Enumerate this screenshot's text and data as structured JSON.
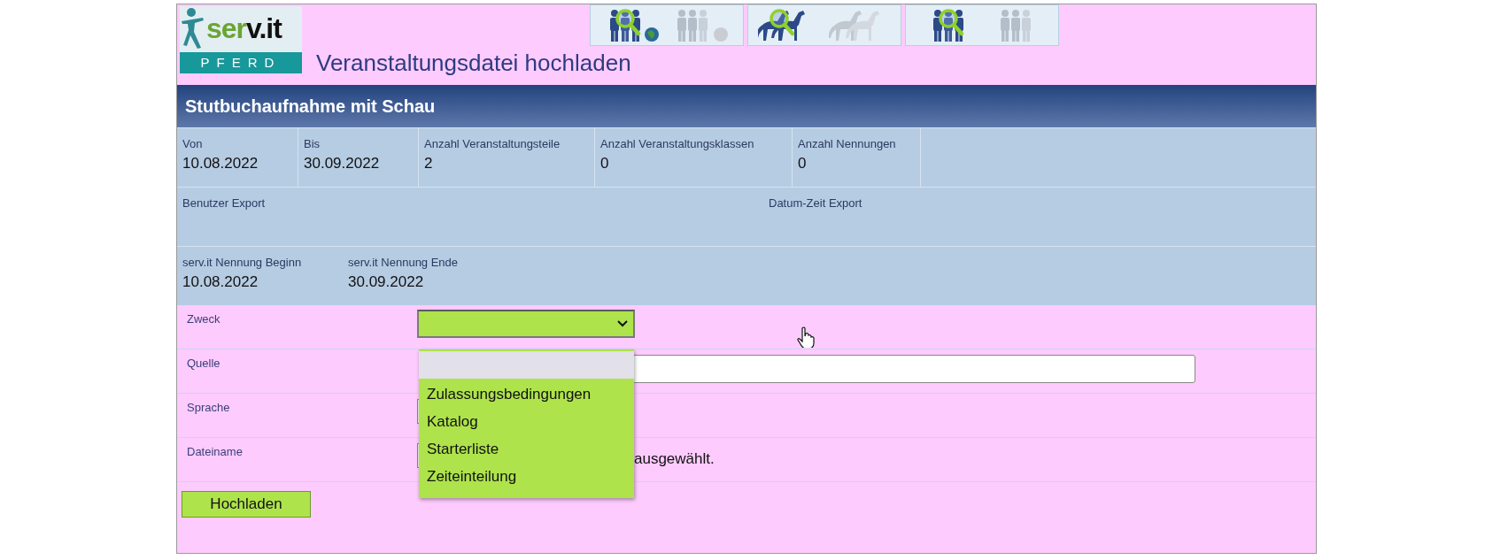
{
  "logo": {
    "word": "serv.it",
    "tagline": "PFERD"
  },
  "page_title": "Veranstaltungsdatei hochladen",
  "nav_icons": [
    {
      "kind": "people-globe"
    },
    {
      "kind": "horses"
    },
    {
      "kind": "people"
    }
  ],
  "event_title": "Stutbuchaufnahme mit Schau",
  "info_rows": [
    [
      {
        "label": "Von",
        "value": "10.08.2022"
      },
      {
        "label": "Bis",
        "value": "30.09.2022"
      },
      {
        "label": "Anzahl Veranstaltungsteile",
        "value": "2"
      },
      {
        "label": "Anzahl Veranstaltungsklassen",
        "value": "0"
      },
      {
        "label": "Anzahl Nennungen",
        "value": "0"
      }
    ],
    [
      {
        "label": "Benutzer Export"
      },
      {
        "label": "Datum-Zeit Export"
      }
    ],
    [
      {
        "label": "serv.it Nennung Beginn",
        "value": "10.08.2022"
      },
      {
        "label": "serv.it Nennung Ende",
        "value": "30.09.2022"
      }
    ]
  ],
  "form": [
    {
      "kind": "select",
      "label": "Zweck"
    },
    {
      "kind": "text",
      "label": "Quelle"
    },
    {
      "kind": "select-hidden",
      "label": "Sprache"
    },
    {
      "kind": "file",
      "label": "Dateiname",
      "status": "ausgewählt."
    }
  ],
  "dropdown": {
    "blank_option_highlighted": true,
    "options": [
      {
        "label": "Zulassungsbedingungen",
        "selected": false
      },
      {
        "label": "Katalog",
        "selected": false
      },
      {
        "label": "Starterliste",
        "selected": false
      },
      {
        "label": "Zeiteinteilung",
        "selected": false
      }
    ]
  },
  "submit_button": "Hochladen"
}
